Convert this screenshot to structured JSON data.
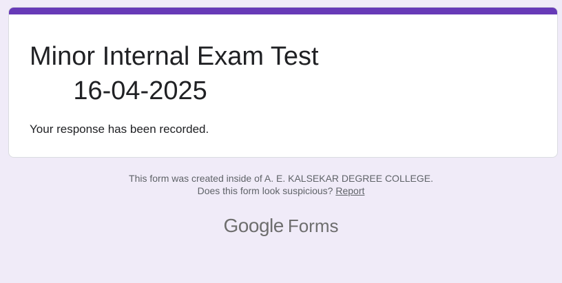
{
  "form": {
    "title_line1": "Minor Internal Exam Test",
    "title_line2": "      16-04-2025",
    "confirmation": "Your response has been recorded."
  },
  "footer": {
    "created_inside": "This form was created inside of A. E. KALSEKAR DEGREE COLLEGE.",
    "suspicious_prompt": "Does this form look suspicious?",
    "report_link": "Report"
  },
  "branding": {
    "google": "Google",
    "forms": "Forms"
  },
  "colors": {
    "accent": "#673ab7",
    "background": "#f0ebf8"
  }
}
